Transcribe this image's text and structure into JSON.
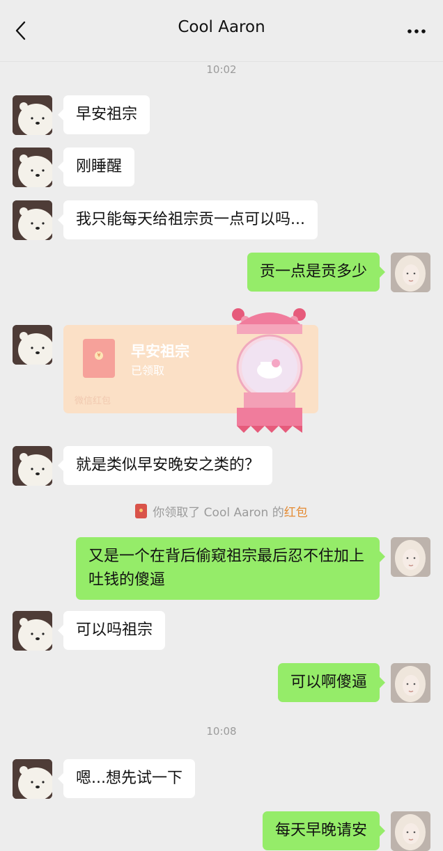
{
  "header": {
    "back_icon": "chevron-left-icon",
    "title": "Cool Aaron",
    "more_icon": "more-dots-icon"
  },
  "timestamps": [
    "10:02",
    "10:08"
  ],
  "messages": [
    {
      "side": "left",
      "text": "早安祖宗"
    },
    {
      "side": "left",
      "text": "刚睡醒"
    },
    {
      "side": "left",
      "text": "我只能每天给祖宗贡一点可以吗..."
    },
    {
      "side": "right",
      "text": "贡一点是贡多少"
    },
    {
      "side": "left",
      "text": "就是类似早安晚安之类的？"
    },
    {
      "side": "right",
      "text": "又是一个在背后偷窥祖宗最后忍不住加上吐钱的傻逼"
    },
    {
      "side": "left",
      "text": "可以吗祖宗"
    },
    {
      "side": "right",
      "text": "可以啊傻逼"
    },
    {
      "side": "left",
      "text": "嗯...想先试一下"
    },
    {
      "side": "right",
      "text": "每天早晚请安"
    }
  ],
  "red_packet": {
    "title": "早安祖宗",
    "status": "已领取",
    "footer": "微信红包",
    "icon": "red-packet-icon"
  },
  "sticker": {
    "icon": "carousel-sticker"
  },
  "system_message": {
    "prefix": "你领取了 Cool Aaron 的",
    "link": "红包"
  },
  "colors": {
    "background": "#ededed",
    "incoming_bubble": "#ffffff",
    "outgoing_bubble": "#95ec69",
    "red_packet": "#fbe0c6",
    "link": "#e48a32"
  }
}
